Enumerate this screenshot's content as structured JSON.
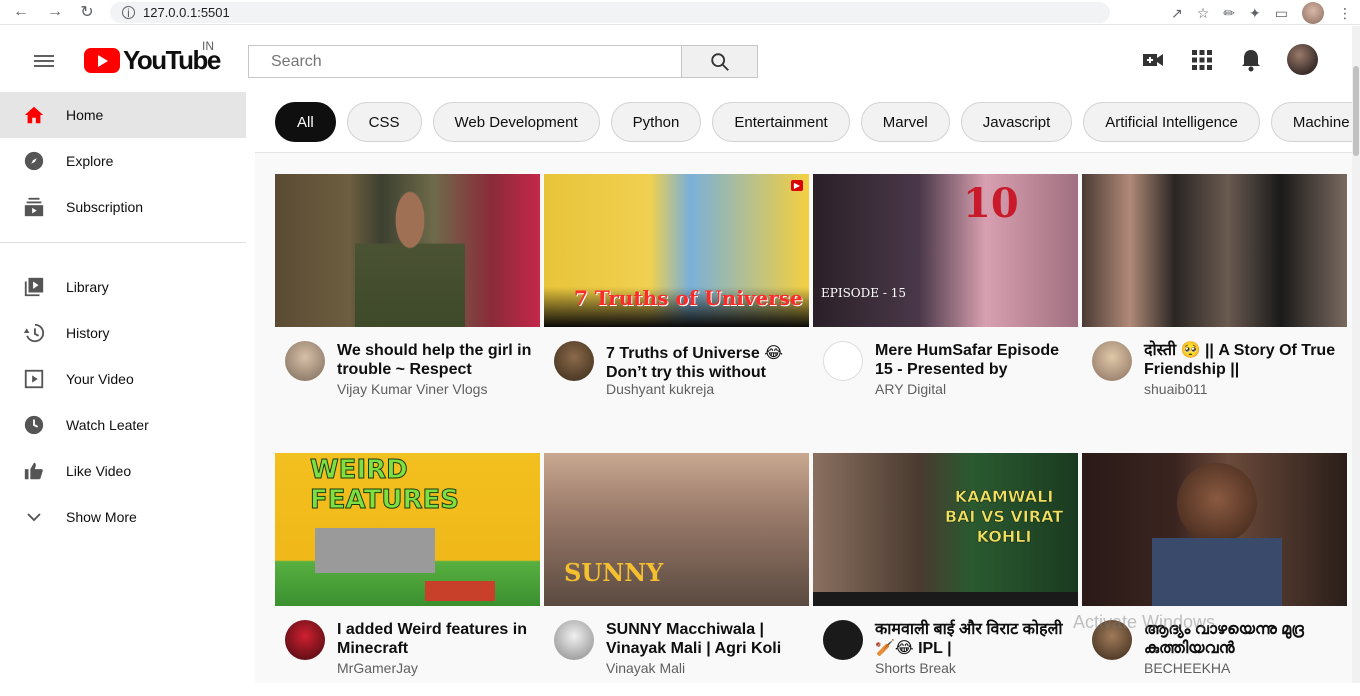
{
  "browser": {
    "url": "127.0.0.1:5501"
  },
  "header": {
    "logo_text": "YouTube",
    "region": "IN",
    "search_placeholder": "Search"
  },
  "sidebar": {
    "items": [
      {
        "label": "Home",
        "icon": "home-icon",
        "active": true
      },
      {
        "label": "Explore",
        "icon": "compass-icon"
      },
      {
        "label": "Subscription",
        "icon": "subscriptions-icon"
      }
    ],
    "items2": [
      {
        "label": "Library",
        "icon": "library-icon"
      },
      {
        "label": "History",
        "icon": "history-icon"
      },
      {
        "label": "Your Video",
        "icon": "play-square-icon"
      },
      {
        "label": "Watch Leater",
        "icon": "clock-icon"
      },
      {
        "label": "Like Video",
        "icon": "thumbs-up-icon"
      },
      {
        "label": "Show More",
        "icon": "chevron-down-icon"
      }
    ]
  },
  "chips": [
    "All",
    "CSS",
    "Web Development",
    "Python",
    "Entertainment",
    "Marvel",
    "Javascript",
    "Artificial Intelligence",
    "Machine"
  ],
  "videos": [
    {
      "title": "We should help the girl in trouble ~ Respect",
      "channel": "Vijay Kumar Viner Vlogs"
    },
    {
      "title": "7 Truths of Universe 😂 Don’t try this without",
      "channel": "Dushyant kukreja",
      "thumb_text": "7 Truths of Universe"
    },
    {
      "title": "Mere HumSafar Episode 15 - Presented by",
      "channel": "ARY Digital",
      "thumb_text": "EPISODE - 15"
    },
    {
      "title": "दोस्ती 🥺 || A Story Of True Friendship ||",
      "channel": "shuaib011"
    },
    {
      "title": "I added Weird features in Minecraft",
      "channel": "MrGamerJay",
      "thumb_text": "WEIRD FEATURES"
    },
    {
      "title": "SUNNY Macchiwala | Vinayak Mali | Agri Koli",
      "channel": "Vinayak Mali",
      "thumb_text": "SUNNY"
    },
    {
      "title": "कामवाली बाई और विराट कोहली 🏏😂 IPL |",
      "channel": "Shorts Break",
      "thumb_text": "KAAMWALI BAI VS VIRAT KOHLI"
    },
    {
      "title": "ആദ്യം വാഴയെന്നു മുദ്ര കുത്തിയവൻ",
      "channel": "BECHEEKHA"
    }
  ],
  "watermark": "Activate Windows"
}
